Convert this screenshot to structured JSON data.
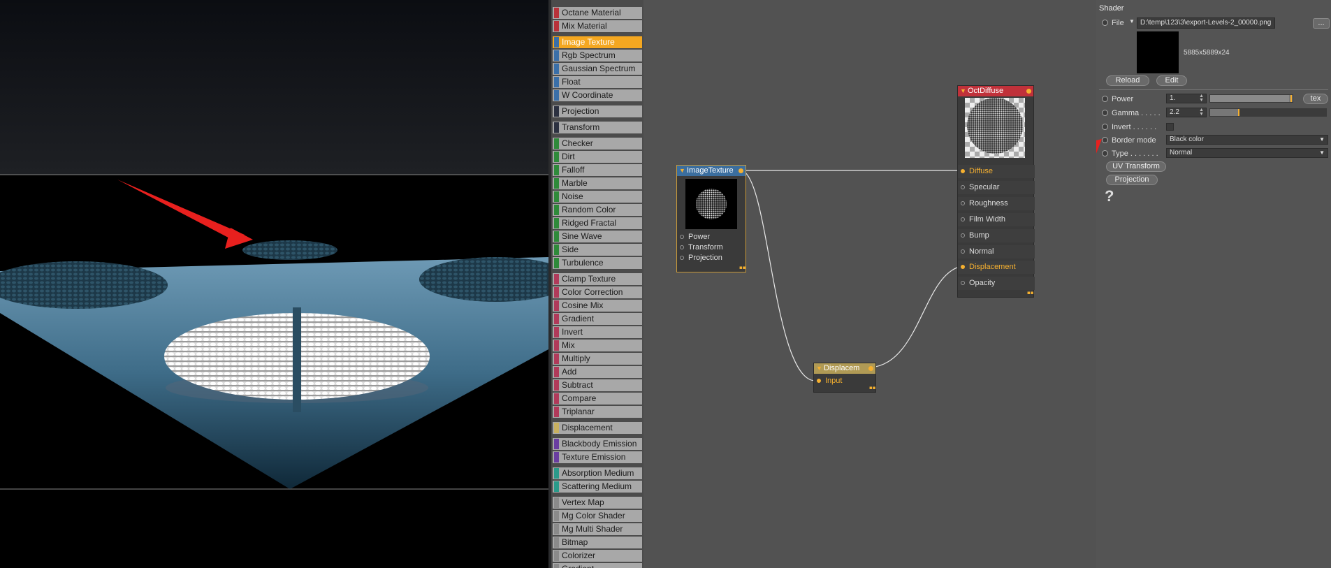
{
  "node_categories": [
    {
      "label": "Octane Material",
      "color": "#b8323a"
    },
    {
      "label": "Mix Material",
      "color": "#b8323a"
    },
    {
      "label": "Image Texture",
      "color": "#3a6fa8",
      "selected": true
    },
    {
      "label": "Rgb Spectrum",
      "color": "#3a6fa8"
    },
    {
      "label": "Gaussian Spectrum",
      "color": "#3a6fa8"
    },
    {
      "label": "Float",
      "color": "#3a6fa8"
    },
    {
      "label": "W Coordinate",
      "color": "#3a6fa8"
    },
    {
      "label": "Projection",
      "color": "#2c3140"
    },
    {
      "label": "Transform",
      "color": "#2c3140"
    },
    {
      "label": "Checker",
      "color": "#2f8a3a"
    },
    {
      "label": "Dirt",
      "color": "#2f8a3a"
    },
    {
      "label": "Falloff",
      "color": "#2f8a3a"
    },
    {
      "label": "Marble",
      "color": "#2f8a3a"
    },
    {
      "label": "Noise",
      "color": "#2f8a3a"
    },
    {
      "label": "Random Color",
      "color": "#2f8a3a"
    },
    {
      "label": "Ridged Fractal",
      "color": "#2f8a3a"
    },
    {
      "label": "Sine Wave",
      "color": "#2f8a3a"
    },
    {
      "label": "Side",
      "color": "#2f8a3a"
    },
    {
      "label": "Turbulence",
      "color": "#2f8a3a"
    },
    {
      "label": "Clamp Texture",
      "color": "#b03a5a"
    },
    {
      "label": "Color Correction",
      "color": "#b03a5a"
    },
    {
      "label": "Cosine Mix",
      "color": "#b03a5a"
    },
    {
      "label": "Gradient",
      "color": "#b03a5a"
    },
    {
      "label": "Invert",
      "color": "#b03a5a"
    },
    {
      "label": "Mix",
      "color": "#b03a5a"
    },
    {
      "label": "Multiply",
      "color": "#b03a5a"
    },
    {
      "label": "Add",
      "color": "#b03a5a"
    },
    {
      "label": "Subtract",
      "color": "#b03a5a"
    },
    {
      "label": "Compare",
      "color": "#b03a5a"
    },
    {
      "label": "Triplanar",
      "color": "#b03a5a"
    },
    {
      "label": "Displacement",
      "color": "#c8b060"
    },
    {
      "label": "Blackbody Emission",
      "color": "#6a3ea0"
    },
    {
      "label": "Texture Emission",
      "color": "#6a3ea0"
    },
    {
      "label": "Absorption Medium",
      "color": "#2a9a8a"
    },
    {
      "label": "Scattering Medium",
      "color": "#2a9a8a"
    },
    {
      "label": "Vertex Map",
      "color": "#8a8a8a"
    },
    {
      "label": "Mg Color Shader",
      "color": "#8a8a8a"
    },
    {
      "label": "Mg Multi Shader",
      "color": "#8a8a8a"
    },
    {
      "label": "Bitmap",
      "color": "#8a8a8a"
    },
    {
      "label": "Colorizer",
      "color": "#8a8a8a"
    },
    {
      "label": "Gradient",
      "color": "#8a8a8a"
    }
  ],
  "nodes": {
    "image_texture": {
      "title": "ImageTexture",
      "header_color": "#3b6e9e",
      "ports": [
        "Power",
        "Transform",
        "Projection"
      ]
    },
    "oct_diffuse": {
      "title": "OctDiffuse",
      "header_color": "#c0313a",
      "ports": [
        "Diffuse",
        "Specular",
        "Roughness",
        "Film Width",
        "Bump",
        "Normal",
        "Displacement",
        "Opacity"
      ],
      "active_ports": [
        "Diffuse",
        "Displacement"
      ]
    },
    "displacement": {
      "title": "Displacem",
      "header_color": "#b09a55",
      "ports": [
        "Input"
      ]
    }
  },
  "attributes": {
    "section_title": "Shader",
    "file_label": "File",
    "file_path": "D:\\temp\\123\\3\\export-Levels-2_00000.png",
    "browse_label": "...",
    "image_info": "5885x5889x24",
    "reload_label": "Reload",
    "edit_label": "Edit",
    "power_label": "Power",
    "power_value": "1.",
    "tex_label": "tex",
    "gamma_label": "Gamma . . . . .",
    "gamma_value": "2.2",
    "invert_label": "Invert . . . . . .",
    "border_mode_label": "Border mode",
    "border_mode_value": "Black color",
    "type_label": "Type . . . . . . .",
    "type_value": "Normal",
    "uv_transform_label": "UV Transform",
    "projection_label": "Projection",
    "help_glyph": "?"
  },
  "colors": {
    "accent": "#f5b030",
    "annotation_arrow": "#e8201e"
  }
}
